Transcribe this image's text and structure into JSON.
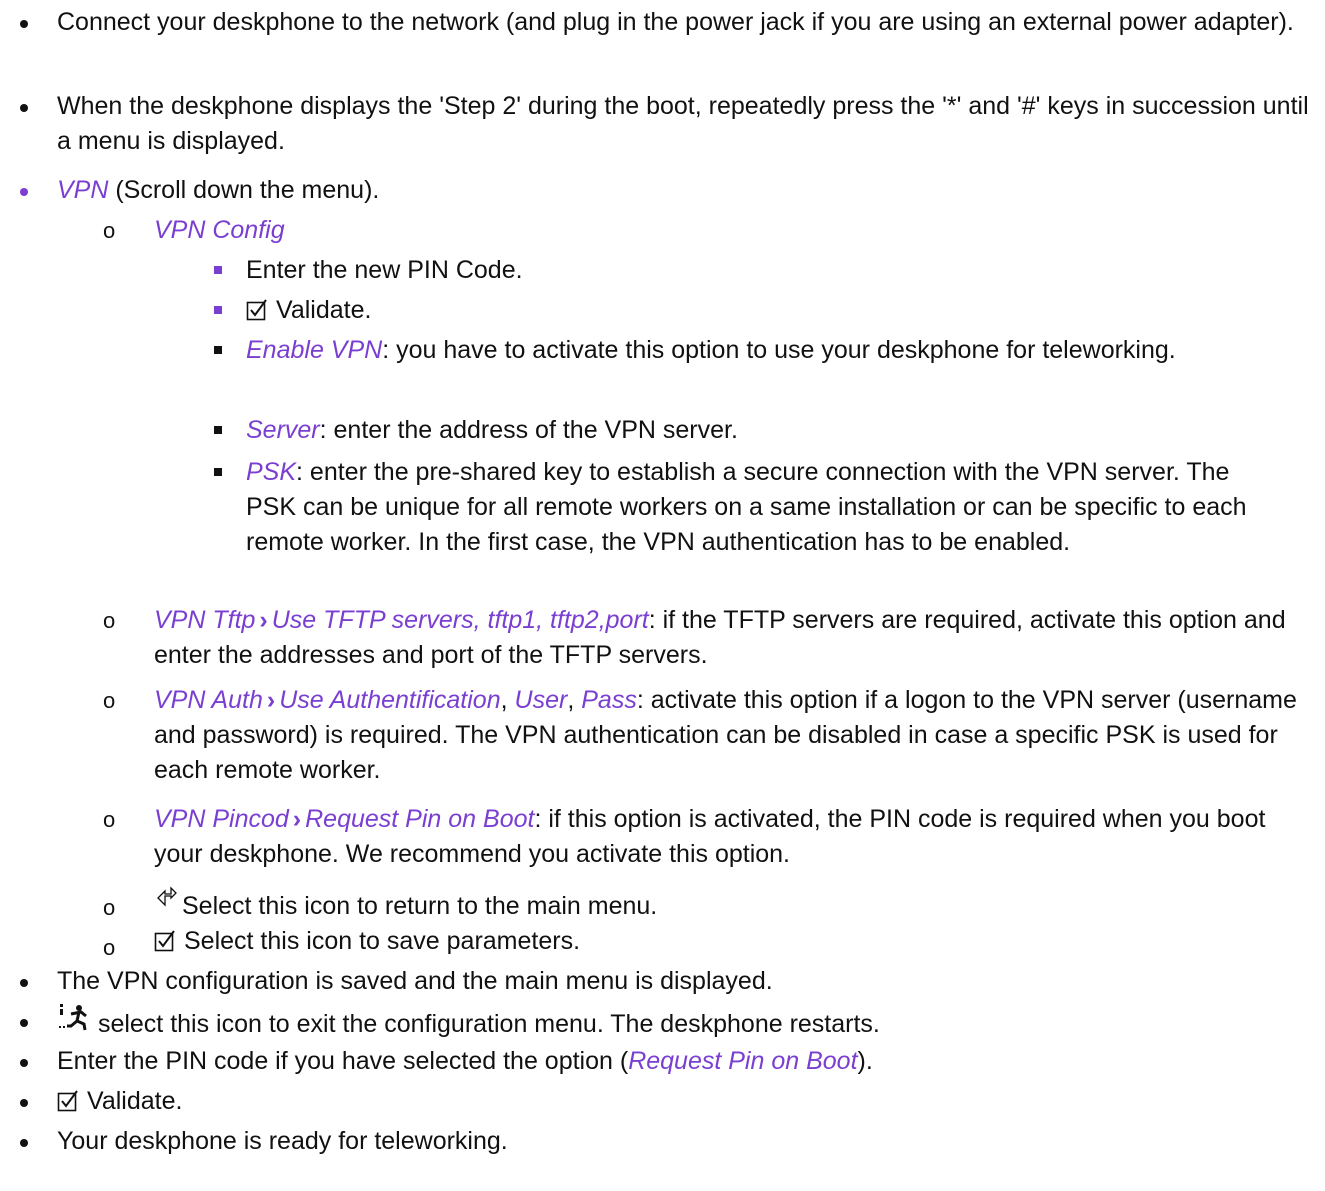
{
  "bullets": {
    "b1": "Connect your deskphone to the network (and plug in the power jack if you are using an external power adapter).",
    "b2": "When the deskphone displays the 'Step 2' during the boot, repeatedly press the '*' and '#' keys in succession until a menu is displayed.",
    "b3_em": "VPN",
    "b3_rest": " (Scroll down the menu).",
    "b4": "The VPN configuration is saved and the main menu is displayed.",
    "b5": " select this icon to exit the configuration menu. The deskphone restarts.",
    "b6_a": "Enter the PIN code if you have selected the option (",
    "b6_em": "Request Pin on Boot",
    "b6_b": ").",
    "b7": "Validate.",
    "b8": "Your deskphone is ready for teleworking."
  },
  "sub": {
    "s1_em": "VPN Config",
    "s2_em1": "VPN Tftp",
    "s2_em2": "Use TFTP servers, tftp1, tftp2,port",
    "s2_rest": ": if the TFTP servers are required, activate this option and enter the addresses and port of the TFTP servers.",
    "s3_em1": "VPN Auth",
    "s3_em2": "Use Authentification",
    "s3_sep": ", ",
    "s3_em3": "User",
    "s3_em4": "Pass",
    "s3_rest": ": activate this option if a logon to the VPN server (username and password) is required. The VPN authentication can be disabled in case a specific PSK is used for each remote worker.",
    "s4_em1": "VPN Pincod",
    "s4_em2": "Request Pin on Boot",
    "s4_rest": ": if this option is activated, the PIN code is required when you boot your deskphone. We recommend you activate this option.",
    "s5": "Select this icon to return to the main menu.",
    "s6": "Select this icon to save parameters."
  },
  "subsub": {
    "t1": "Enter the new PIN Code.",
    "t2": "Validate.",
    "t3_em": "Enable VPN",
    "t3_rest": ": you have to activate this option to use your deskphone for teleworking.",
    "t4_em": "Server",
    "t4_rest": ": enter the address of the VPN server.",
    "t5_em": "PSK",
    "t5_rest": ": enter the pre-shared key to establish a secure connection with the VPN server. The PSK can be unique for all remote workers on a same installation or can be specific to each remote worker. In the first case, the VPN authentication has to be enabled."
  },
  "glyphs": {
    "sub_bullet": "o",
    "chevron": "›"
  },
  "icons": {
    "validate": "checkbox-check-icon",
    "back": "return-arrow-icon",
    "exit": "running-man-exit-icon"
  },
  "colors": {
    "accent": "#7a3fd1",
    "text": "#111111"
  }
}
